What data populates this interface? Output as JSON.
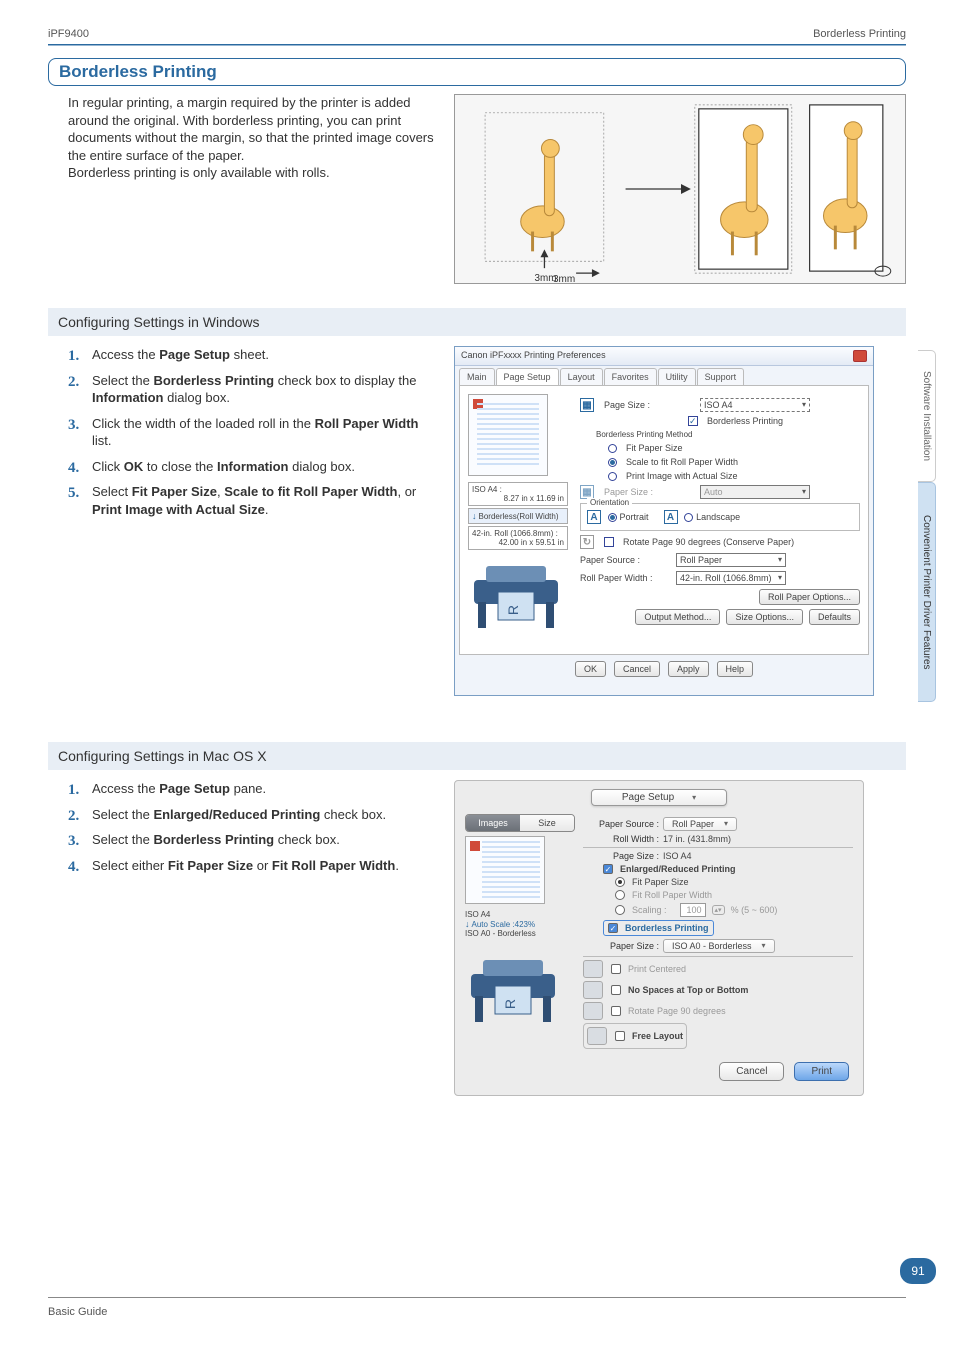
{
  "header": {
    "left": "iPF9400",
    "right": "Borderless Printing"
  },
  "title": "Borderless Printing",
  "intro": {
    "p1": "In regular printing, a margin required by the printer is added around the original. With borderless printing, you can print documents without the margin, so that the printed image covers the entire surface of the paper.",
    "p2": "Borderless printing is only available with rolls."
  },
  "diagram": {
    "mm1": "3mm",
    "mm2": "3mm"
  },
  "sections": {
    "win": "Configuring Settings in Windows",
    "mac": "Configuring Settings in Mac OS X"
  },
  "win_steps": {
    "s1a": "Access the ",
    "s1b": "Page Setup",
    "s1c": " sheet.",
    "s2a": "Select the ",
    "s2b": "Borderless Printing",
    "s2c": " check box to display the ",
    "s2d": "Information",
    "s2e": " dialog box.",
    "s3a": "Click the width of the loaded roll in the ",
    "s3b": "Roll Paper Width",
    "s3c": " list.",
    "s4a": "Click ",
    "s4b": "OK",
    "s4c": " to close the ",
    "s4d": "Information",
    "s4e": " dialog box.",
    "s5a": "Select ",
    "s5b": "Fit Paper Size",
    "s5c": ", ",
    "s5d": "Scale to fit Roll Paper Width",
    "s5e": ", or ",
    "s5f": "Print Image with Actual Size",
    "s5g": "."
  },
  "mac_steps": {
    "s1a": "Access the ",
    "s1b": "Page Setup",
    "s1c": " pane.",
    "s2a": "Select the ",
    "s2b": "Enlarged/Reduced Printing",
    "s2c": " check box.",
    "s3a": "Select the ",
    "s3b": "Borderless Printing",
    "s3c": " check box.",
    "s4a": "Select either ",
    "s4b": "Fit Paper Size",
    "s4c": " or ",
    "s4d": "Fit Roll Paper Width",
    "s4e": "."
  },
  "win_dialog": {
    "title": "Canon iPFxxxx Printing Preferences",
    "tabs": [
      "Main",
      "Page Setup",
      "Layout",
      "Favorites",
      "Utility",
      "Support"
    ],
    "active_tab": "Page Setup",
    "page_size_label": "Page Size :",
    "page_size_value": "ISO A4",
    "borderless_chk": "Borderless Printing",
    "method_label": "Borderless Printing Method",
    "m1": "Fit Paper Size",
    "m2": "Scale to fit Roll Paper Width",
    "m3": "Print Image with Actual Size",
    "paper_size_label": "Paper Size :",
    "paper_size_value": "Auto",
    "orientation_label": "Orientation",
    "portrait": "Portrait",
    "landscape": "Landscape",
    "rotate": "Rotate Page 90 degrees (Conserve Paper)",
    "paper_source_label": "Paper Source :",
    "paper_source_value": "Roll Paper",
    "roll_width_label": "Roll Paper Width :",
    "roll_width_value": "42-in. Roll (1066.8mm)",
    "roll_options_btn": "Roll Paper Options...",
    "output_btn": "Output Method...",
    "size_opts_btn": "Size Options...",
    "defaults_btn": "Defaults",
    "ok": "OK",
    "cancel": "Cancel",
    "apply": "Apply",
    "help": "Help",
    "preview1_title": "ISO A4 :",
    "preview1_dim": "8.27 in x 11.69 in",
    "preview1_arrow": "Borderless(Roll Width)",
    "preview2_title": "42-in. Roll (1066.8mm) :",
    "preview2_dim": "42.00 in x 59.51 in"
  },
  "mac_dialog": {
    "pane": "Page Setup",
    "tabs": {
      "a": "Images",
      "b": "Size"
    },
    "paper_source_label": "Paper Source :",
    "paper_source_value": "Roll Paper",
    "roll_width_label": "Roll Width :",
    "roll_width_value": "17 in. (431.8mm)",
    "page_size_label": "Page Size :",
    "page_size_value": "ISO A4",
    "enlarged": "Enlarged/Reduced Printing",
    "fit_paper": "Fit Paper Size",
    "fit_roll": "Fit Roll Paper Width",
    "scaling_label": "Scaling :",
    "scaling_value": "100",
    "scaling_range": "% (5 ~ 600)",
    "borderless": "Borderless Printing",
    "paper_size2_label": "Paper Size :",
    "paper_size2_value": "ISO A0 - Borderless",
    "print_centered": "Print Centered",
    "no_spaces": "No Spaces at Top or Bottom",
    "rotate": "Rotate Page 90 degrees",
    "free_layout": "Free Layout",
    "preview_title": "ISO A4",
    "preview_scale": "Auto Scale :423%",
    "preview_out": "ISO A0 - Borderless",
    "cancel": "Cancel",
    "print": "Print"
  },
  "side_tabs": {
    "inactive": "Software Installation",
    "active": "Convenient Printer Driver Features"
  },
  "footer": {
    "guide": "Basic Guide",
    "page": "91"
  }
}
